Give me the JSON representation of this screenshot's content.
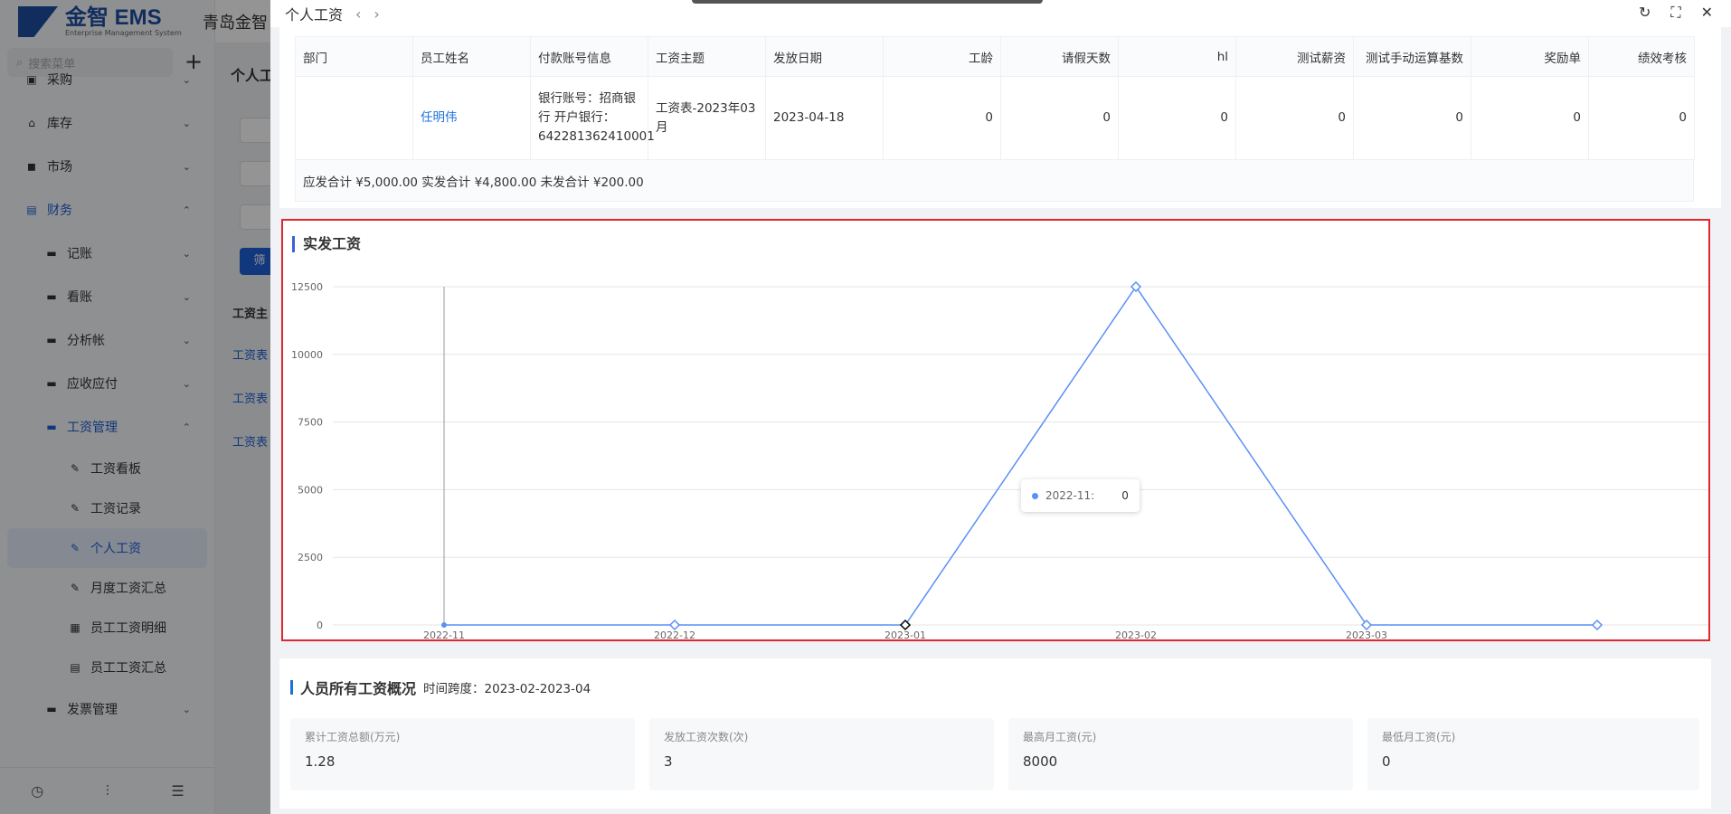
{
  "app": {
    "logo_text": "金智 EMS",
    "logo_sub": "Enterprise Management System",
    "company": "青岛金智",
    "search_placeholder": "搜索菜单"
  },
  "sidebar": {
    "items": [
      {
        "label": "采购",
        "level": 0
      },
      {
        "label": "库存",
        "level": 0
      },
      {
        "label": "市场",
        "level": 0
      },
      {
        "label": "财务",
        "level": 0
      },
      {
        "label": "记账",
        "level": 1
      },
      {
        "label": "看账",
        "level": 1
      },
      {
        "label": "分析帐",
        "level": 1
      },
      {
        "label": "应收应付",
        "level": 1
      },
      {
        "label": "工资管理",
        "level": 1
      },
      {
        "label": "工资看板",
        "level": 2
      },
      {
        "label": "工资记录",
        "level": 2
      },
      {
        "label": "个人工资",
        "level": 2
      },
      {
        "label": "月度工资汇总",
        "level": 2
      },
      {
        "label": "员工工资明细",
        "level": 2
      },
      {
        "label": "员工工资汇总",
        "level": 2
      },
      {
        "label": "发票管理",
        "level": 1
      }
    ]
  },
  "background": {
    "title": "个人工",
    "filter_btn": "筛",
    "table_header": "工资主",
    "links": [
      "工资表",
      "工资表",
      "工资表"
    ]
  },
  "drawer": {
    "title": "个人工资",
    "table": {
      "headers": [
        "部门",
        "员工姓名",
        "付款账号信息",
        "工资主题",
        "发放日期",
        "工龄",
        "请假天数",
        "hl",
        "测试薪资",
        "测试手动运算基数",
        "奖励单",
        "绩效考核"
      ],
      "row": {
        "dept": "",
        "name": "任明伟",
        "account": "银行账号：招商银行 开户银行：642281362410001",
        "subject": "工资表-2023年03月",
        "date": "2023-04-18",
        "seniority": "0",
        "leave": "0",
        "hl": "0",
        "test_salary": "0",
        "test_base": "0",
        "reward": "0",
        "performance": "0"
      },
      "summary": "应发合计 ¥5,000.00 实发合计 ¥4,800.00 未发合计 ¥200.00"
    },
    "tooltip": {
      "label": "2022-11:",
      "value": "0"
    },
    "overview": {
      "title": "人员所有工资概况",
      "span": "时间跨度：2023-02-2023-04",
      "stats": [
        {
          "label": "累计工资总额(万元)",
          "value": "1.28"
        },
        {
          "label": "发放工资次数(次)",
          "value": "3"
        },
        {
          "label": "最高月工资(元)",
          "value": "8000"
        },
        {
          "label": "最低月工资(元)",
          "value": "0"
        }
      ]
    }
  },
  "chart_data": {
    "type": "line",
    "title": "实发工资",
    "x": [
      "2022-11",
      "2022-12",
      "2023-01",
      "2023-02",
      "2023-03",
      ""
    ],
    "series": [
      {
        "values": [
          0,
          0,
          0,
          12500,
          0,
          0
        ]
      }
    ],
    "ylim": [
      0,
      12500
    ],
    "yticks": [
      0,
      2500,
      5000,
      7500,
      10000,
      12500
    ],
    "grid": true,
    "color": "#5b8ff9"
  }
}
